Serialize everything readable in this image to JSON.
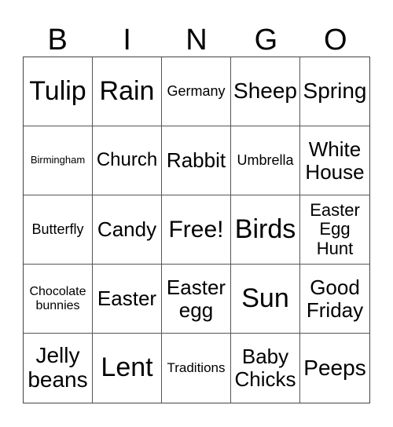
{
  "header": [
    "B",
    "I",
    "N",
    "G",
    "O"
  ],
  "cells": [
    "Tulip",
    "Rain",
    "Germany",
    "Sheep",
    "Spring",
    "Birmingham",
    "Church",
    "Rabbit",
    "Umbrella",
    "White\nHouse",
    "Butterfly",
    "Candy",
    "Free!",
    "Birds",
    "Easter\nEgg\nHunt",
    "Chocolate\nbunnies",
    "Easter",
    "Easter\negg",
    "Sun",
    "Good\nFriday",
    "Jelly\nbeans",
    "Lent",
    "Traditions",
    "Baby\nChicks",
    "Peeps"
  ]
}
